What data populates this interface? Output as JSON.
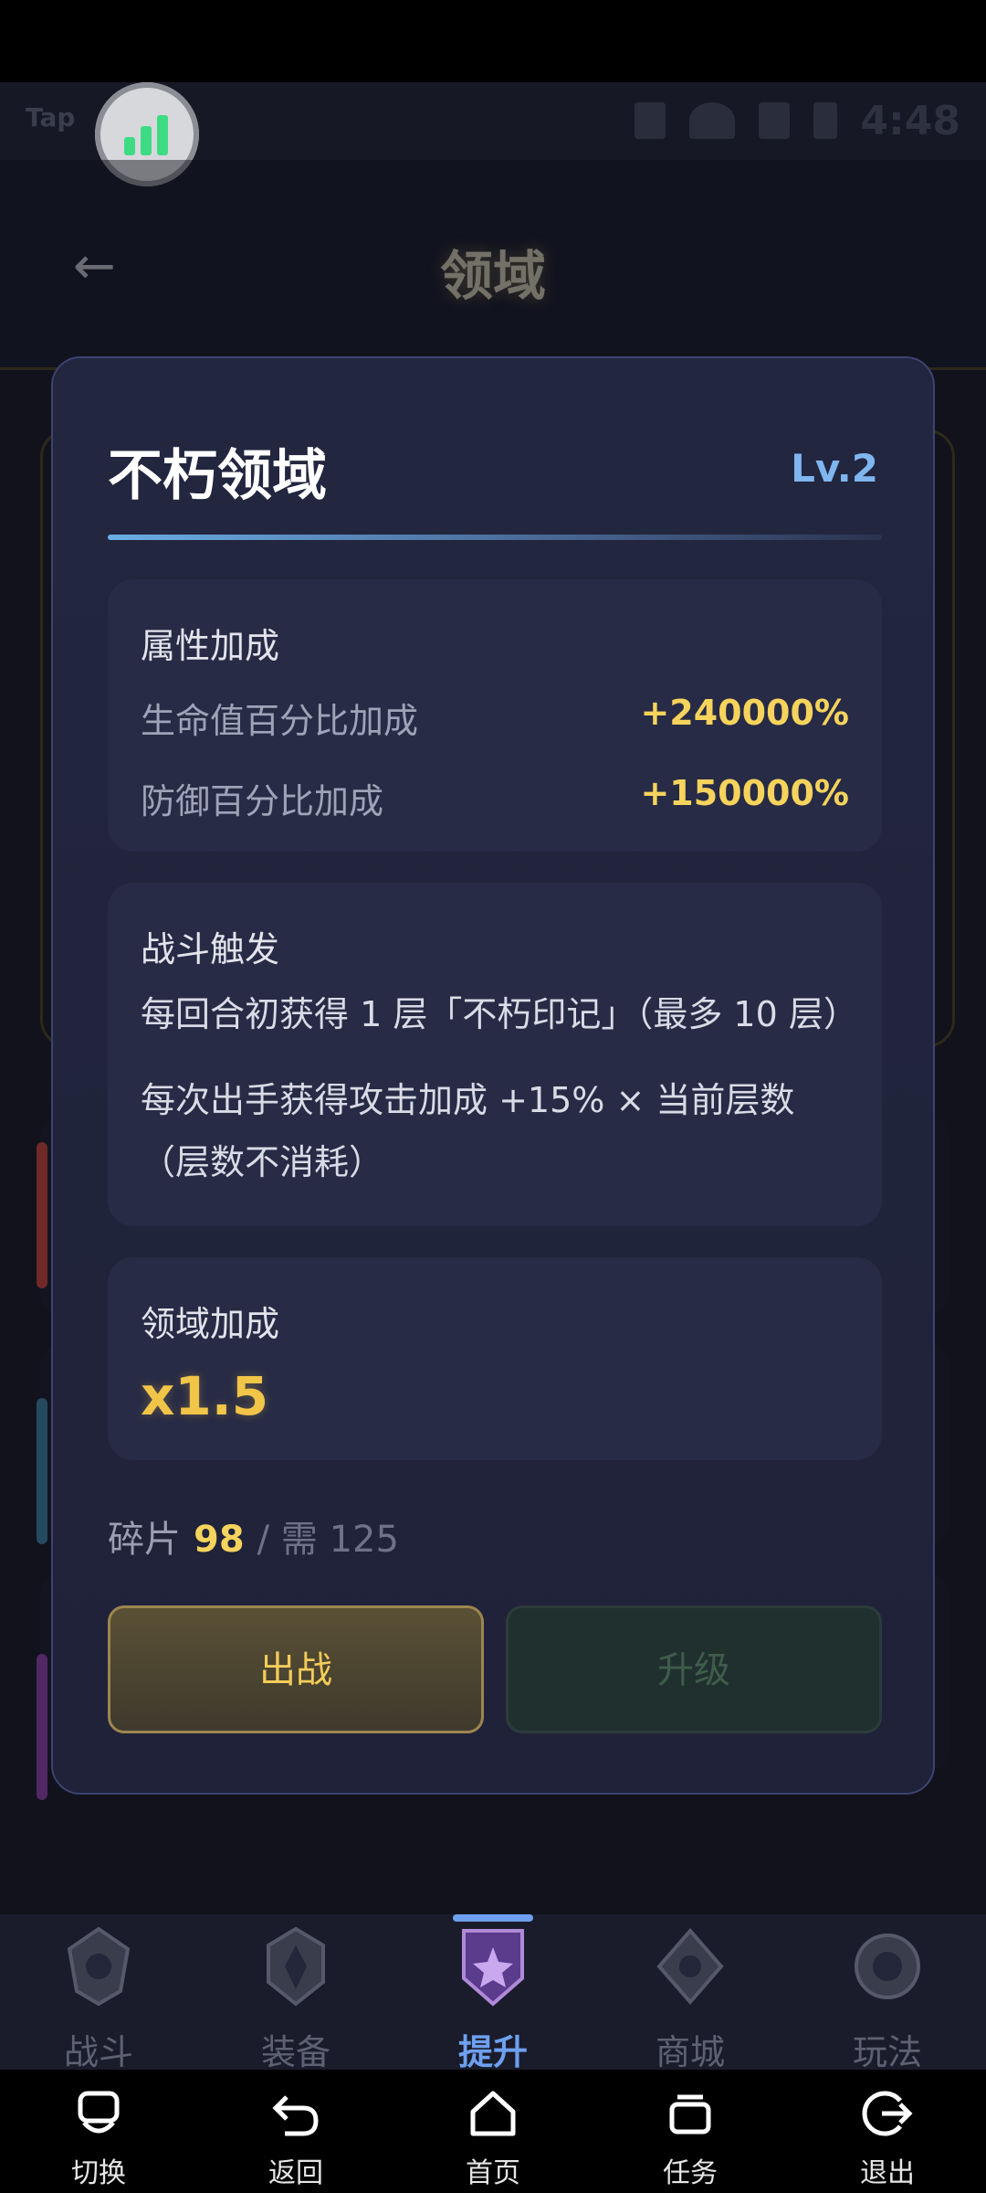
{
  "status_bar": {
    "tap_label": "Tap",
    "time": "4:48"
  },
  "header": {
    "title": "领域"
  },
  "modal": {
    "title": "不朽领域",
    "level": "Lv.2",
    "attributes": {
      "heading": "属性加成",
      "rows": [
        {
          "label": "生命值百分比加成",
          "value": "+240000%"
        },
        {
          "label": "防御百分比加成",
          "value": "+150000%"
        }
      ]
    },
    "trigger": {
      "heading": "战斗触发",
      "lines": [
        "每回合初获得 1 层「不朽印记」（最多 10 层）",
        "每次出手获得攻击加成 +15% × 当前层数（层数不消耗）"
      ]
    },
    "bonus": {
      "heading": "领域加成",
      "value": "x1.5"
    },
    "shards": {
      "label": "碎片",
      "have": "98",
      "need": "/ 需 125"
    },
    "buttons": {
      "battle": "出战",
      "upgrade": "升级"
    }
  },
  "tabbar": {
    "tabs": [
      {
        "label": "战斗",
        "icon": "battle-emblem-icon"
      },
      {
        "label": "装备",
        "icon": "equipment-emblem-icon"
      },
      {
        "label": "提升",
        "icon": "upgrade-emblem-icon",
        "active": true
      },
      {
        "label": "商城",
        "icon": "shop-emblem-icon"
      },
      {
        "label": "玩法",
        "icon": "gameplay-emblem-icon"
      }
    ]
  },
  "navbar": {
    "items": [
      {
        "label": "切换",
        "icon": "switch-icon"
      },
      {
        "label": "返回",
        "icon": "back-icon"
      },
      {
        "label": "首页",
        "icon": "home-icon"
      },
      {
        "label": "任务",
        "icon": "tasks-icon"
      },
      {
        "label": "退出",
        "icon": "exit-icon"
      }
    ]
  },
  "colors": {
    "accent_gold": "#f6d35c",
    "accent_blue": "#7fb6f0",
    "modal_bg": "#22263f",
    "tab_active": "#6ea0ef"
  }
}
